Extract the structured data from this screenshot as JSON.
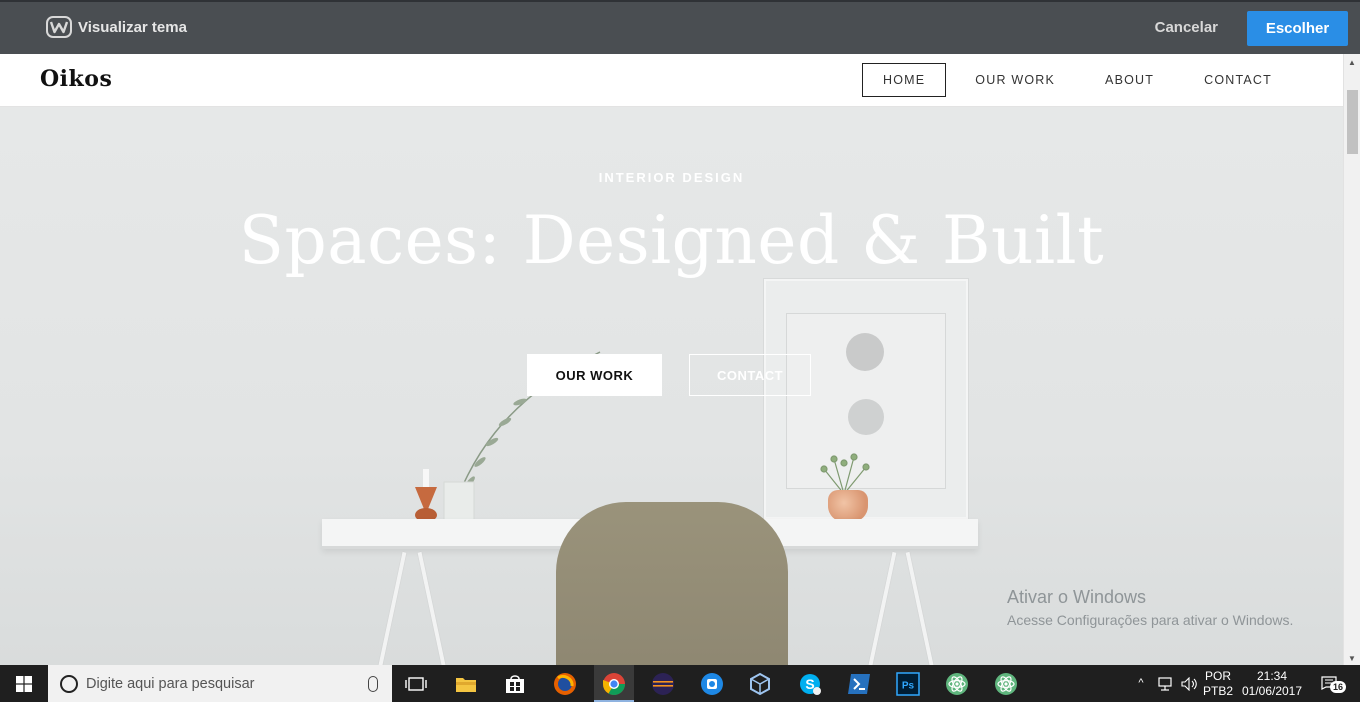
{
  "preview_bar": {
    "title": "Visualizar tema",
    "cancel_label": "Cancelar",
    "choose_label": "Escolher",
    "accent": "#2a8ee6"
  },
  "site": {
    "logo": "Oikos",
    "nav": [
      {
        "label": "HOME",
        "active": true
      },
      {
        "label": "OUR WORK",
        "active": false
      },
      {
        "label": "ABOUT",
        "active": false
      },
      {
        "label": "CONTACT",
        "active": false
      }
    ],
    "hero": {
      "eyebrow": "INTERIOR DESIGN",
      "headline": "Spaces: Designed & Built",
      "primary_button": "OUR WORK",
      "secondary_button": "CONTACT"
    }
  },
  "watermark": {
    "line1": "Ativar o Windows",
    "line2": "Acesse Configurações para ativar o Windows."
  },
  "taskbar": {
    "search_placeholder": "Digite aqui para pesquisar",
    "apps": [
      "task-view",
      "file-explorer",
      "store",
      "firefox",
      "chrome",
      "eclipse",
      "app-blue",
      "virtualbox",
      "skype",
      "powershell",
      "photoshop",
      "atom",
      "atom-2"
    ],
    "language_top": "POR",
    "language_bottom": "PTB2",
    "time": "21:34",
    "date": "01/06/2017",
    "notification_count": "16"
  }
}
